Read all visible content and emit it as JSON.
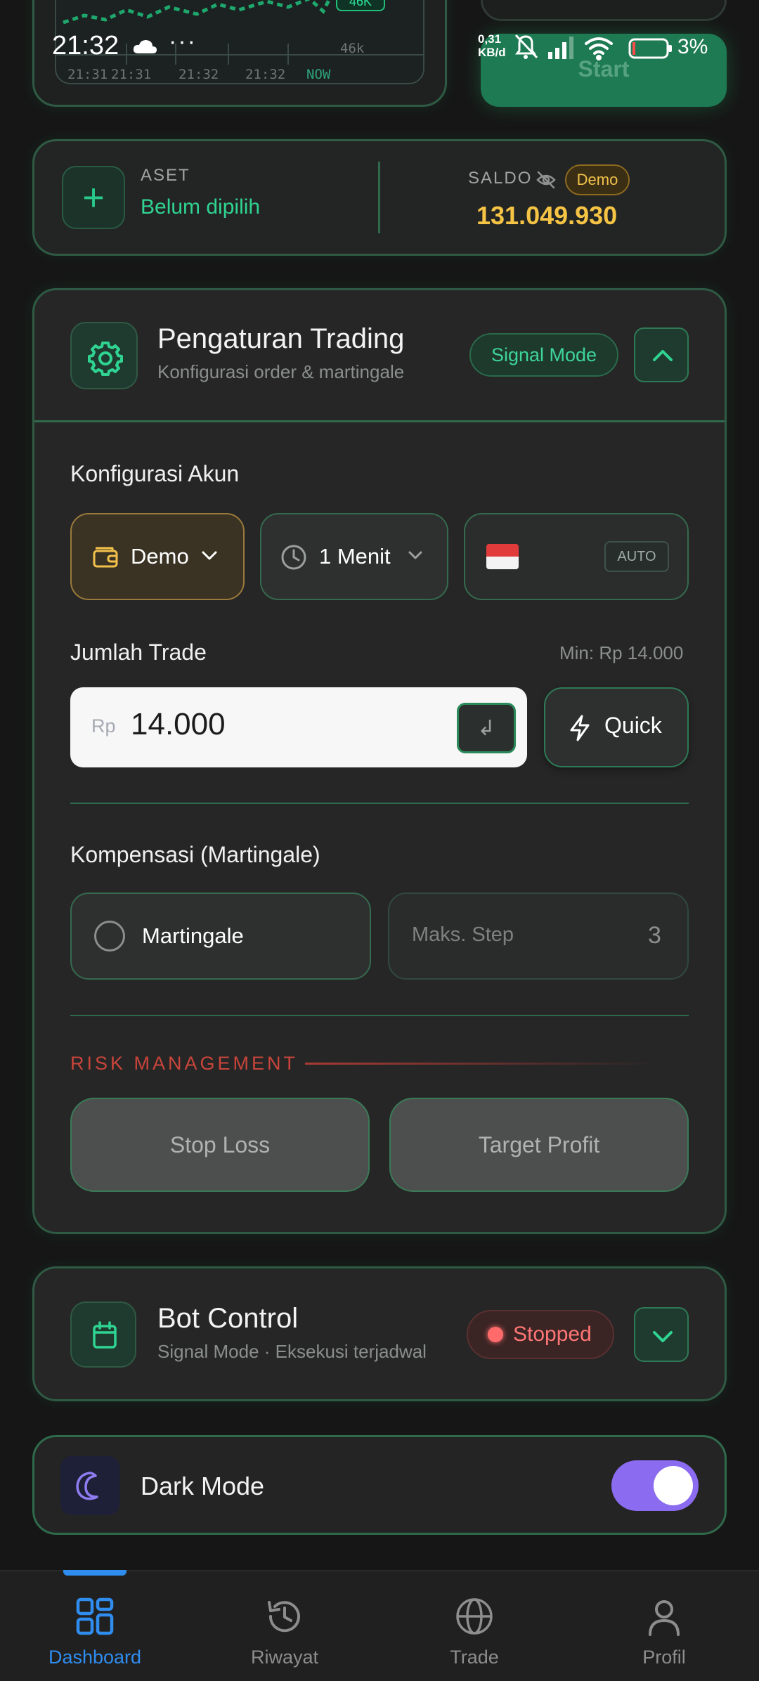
{
  "status_bar": {
    "time": "21:32",
    "dots": "···",
    "net_speed_value": "0,31",
    "net_speed_unit": "KB/d",
    "battery": "3%"
  },
  "chart_preview": {
    "price_tag": "46K",
    "y_tick": "46k",
    "x_ticks": [
      "21:31",
      "21:31",
      "21:32",
      "21:32",
      "NOW"
    ]
  },
  "start_button": {
    "label": "Start"
  },
  "asset_card": {
    "asset_label": "ASET",
    "asset_value": "Belum dipilih",
    "saldo_label": "SALDO",
    "account_badge": "Demo",
    "saldo_value": "131.049.930"
  },
  "trading_settings": {
    "title": "Pengaturan Trading",
    "subtitle": "Konfigurasi order & martingale",
    "mode_chip": "Signal Mode",
    "account_config": {
      "label": "Konfigurasi Akun",
      "account_type": "Demo",
      "timeframe": "1 Menit",
      "auto_chip": "AUTO"
    },
    "trade_amount": {
      "label": "Jumlah Trade",
      "min_label": "Min: Rp 14.000",
      "prefix": "Rp",
      "value": "14.000",
      "enter_symbol": "↲",
      "quick_label": "Quick"
    },
    "martingale": {
      "label": "Kompensasi (Martingale)",
      "toggle_label": "Martingale",
      "max_step_label": "Maks. Step",
      "max_step_value": "3"
    },
    "risk": {
      "label": "RISK MANAGEMENT",
      "stop_loss": "Stop Loss",
      "target_profit": "Target Profit"
    }
  },
  "bot_control": {
    "title": "Bot Control",
    "subtitle": "Signal Mode · Eksekusi terjadwal",
    "status": "Stopped"
  },
  "dark_mode": {
    "label": "Dark Mode",
    "enabled": true
  },
  "bottom_nav": {
    "items": [
      {
        "label": "Dashboard",
        "icon": "dashboard-icon",
        "active": true
      },
      {
        "label": "Riwayat",
        "icon": "history-icon",
        "active": false
      },
      {
        "label": "Trade",
        "icon": "globe-icon",
        "active": false
      },
      {
        "label": "Profil",
        "icon": "user-icon",
        "active": false
      }
    ]
  },
  "colors": {
    "accent_green": "#2fd492",
    "saldo_gold": "#f6c445",
    "danger_red": "#ff6b6b",
    "nav_active_blue": "#2f8df0",
    "toggle_purple": "#8b6cf0"
  }
}
